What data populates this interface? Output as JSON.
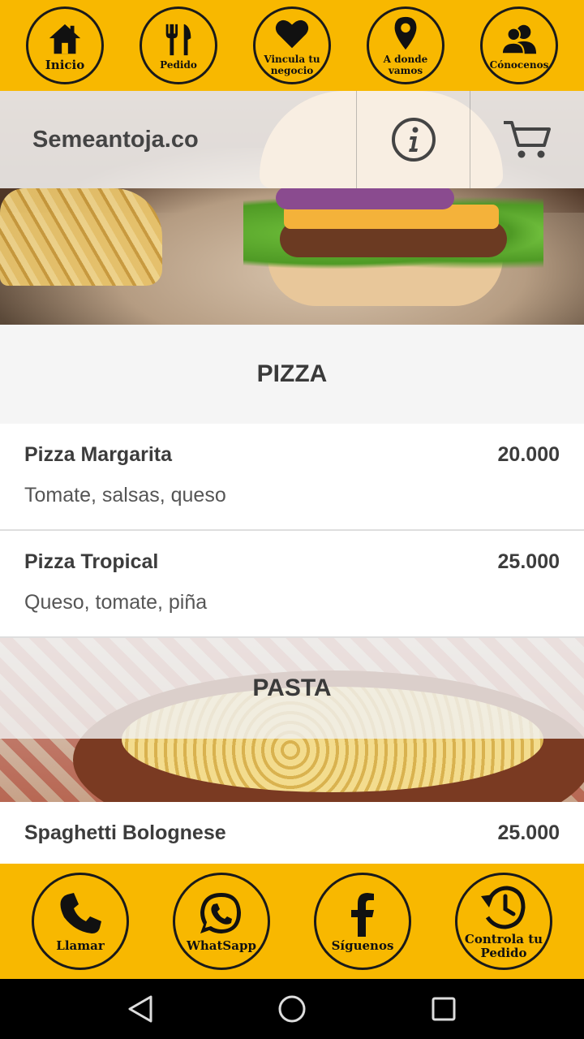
{
  "top_nav": [
    {
      "label": "Inicio",
      "icon": "home-icon"
    },
    {
      "label": "Pedido",
      "icon": "cutlery-icon"
    },
    {
      "label": "Vincula tu negocio",
      "icon": "heart-icon"
    },
    {
      "label": "A donde vamos",
      "icon": "map-pin-icon"
    },
    {
      "label": "Cónocenos",
      "icon": "users-icon"
    }
  ],
  "header": {
    "brand": "Semeantoja.co",
    "info_icon": "info-icon",
    "cart_icon": "cart-icon"
  },
  "sections": [
    {
      "title": "PIZZA",
      "items": [
        {
          "name": "Pizza Margarita",
          "price": "20.000",
          "description": "Tomate, salsas, queso"
        },
        {
          "name": "Pizza Tropical",
          "price": "25.000",
          "description": "Queso, tomate, piña"
        }
      ]
    },
    {
      "title": "PASTA",
      "items": [
        {
          "name": "Spaghetti Bolognese",
          "price": "25.000"
        }
      ]
    }
  ],
  "bottom_nav": [
    {
      "label": "Llamar",
      "icon": "phone-icon"
    },
    {
      "label": "WhatSapp",
      "icon": "whatsapp-icon"
    },
    {
      "label": "Síguenos",
      "icon": "facebook-icon"
    },
    {
      "label": "Controla tu Pedido",
      "icon": "history-clock-icon"
    }
  ],
  "colors": {
    "accent": "#f8b800",
    "text_dark": "#3c3c3c"
  }
}
